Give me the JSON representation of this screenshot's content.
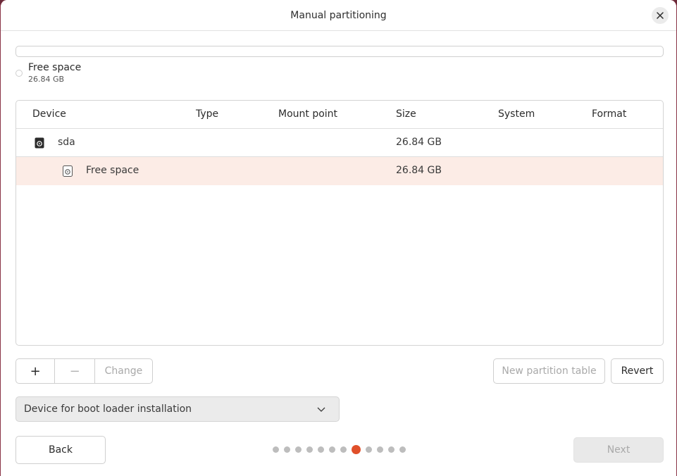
{
  "window": {
    "title": "Manual partitioning"
  },
  "disk_legend": {
    "name": "Free space",
    "size": "26.84 GB"
  },
  "table": {
    "columns": [
      "Device",
      "Type",
      "Mount point",
      "Size",
      "System",
      "Format"
    ],
    "rows": [
      {
        "device": "sda",
        "size": "26.84 GB"
      },
      {
        "device": "Free space",
        "size": "26.84 GB"
      }
    ]
  },
  "actions": {
    "add": "+",
    "remove": "−",
    "change": "Change",
    "new_table": "New partition table",
    "revert": "Revert"
  },
  "bootloader": {
    "label": "Device for boot loader installation"
  },
  "nav": {
    "back": "Back",
    "next": "Next",
    "total_steps": 12,
    "current_step": 8
  },
  "colors": {
    "accent": "#e0502a",
    "selected_row": "#fcece6"
  }
}
